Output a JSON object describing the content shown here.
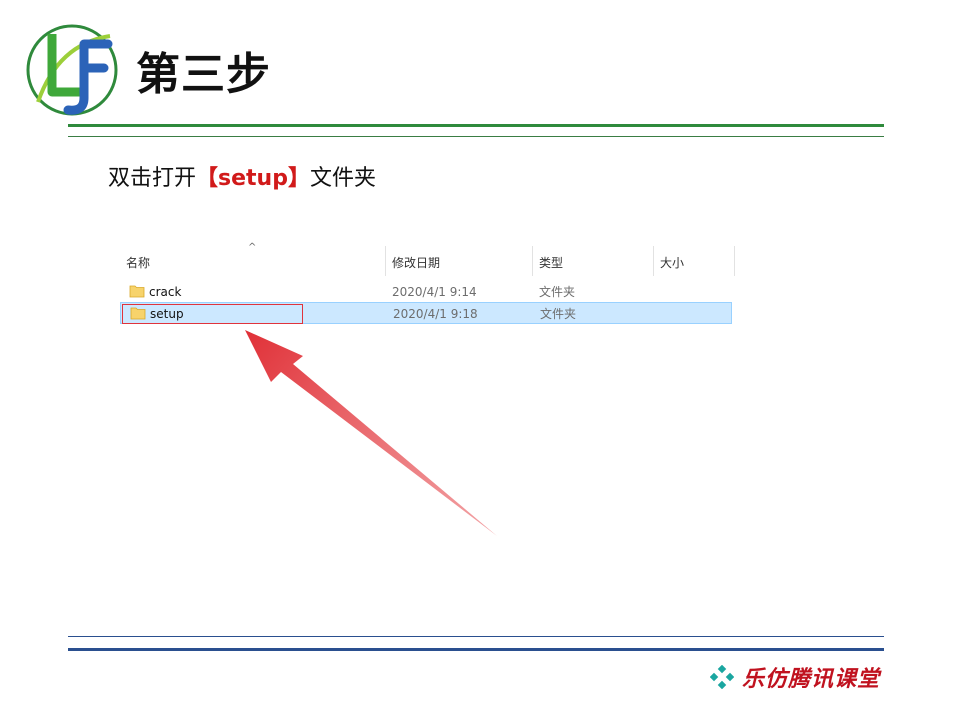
{
  "slide": {
    "title": "第三步"
  },
  "instruction": {
    "prefix": "双击打开",
    "highlight": "【setup】",
    "suffix": "文件夹"
  },
  "explorer": {
    "columns": [
      "名称",
      "修改日期",
      "类型",
      "大小"
    ],
    "rows": [
      {
        "name": "crack",
        "date": "2020/4/1 9:14",
        "type": "文件夹",
        "size": "",
        "selected": false
      },
      {
        "name": "setup",
        "date": "2020/4/1 9:18",
        "type": "文件夹",
        "size": "",
        "selected": true
      }
    ]
  },
  "footer": {
    "brand": "乐仿腾讯课堂"
  },
  "colors": {
    "accent_green": "#2f8a3c",
    "accent_blue": "#2a4f8f",
    "highlight_red": "#d11a1a",
    "selection_bg": "#cce8ff",
    "folder": "#f7d36b"
  },
  "icons": {
    "logo": "lf-logo",
    "folder": "folder-icon",
    "sort": "sort-up-icon",
    "brand_mark": "diamond-cluster-icon",
    "pointer": "red-arrow-icon"
  }
}
